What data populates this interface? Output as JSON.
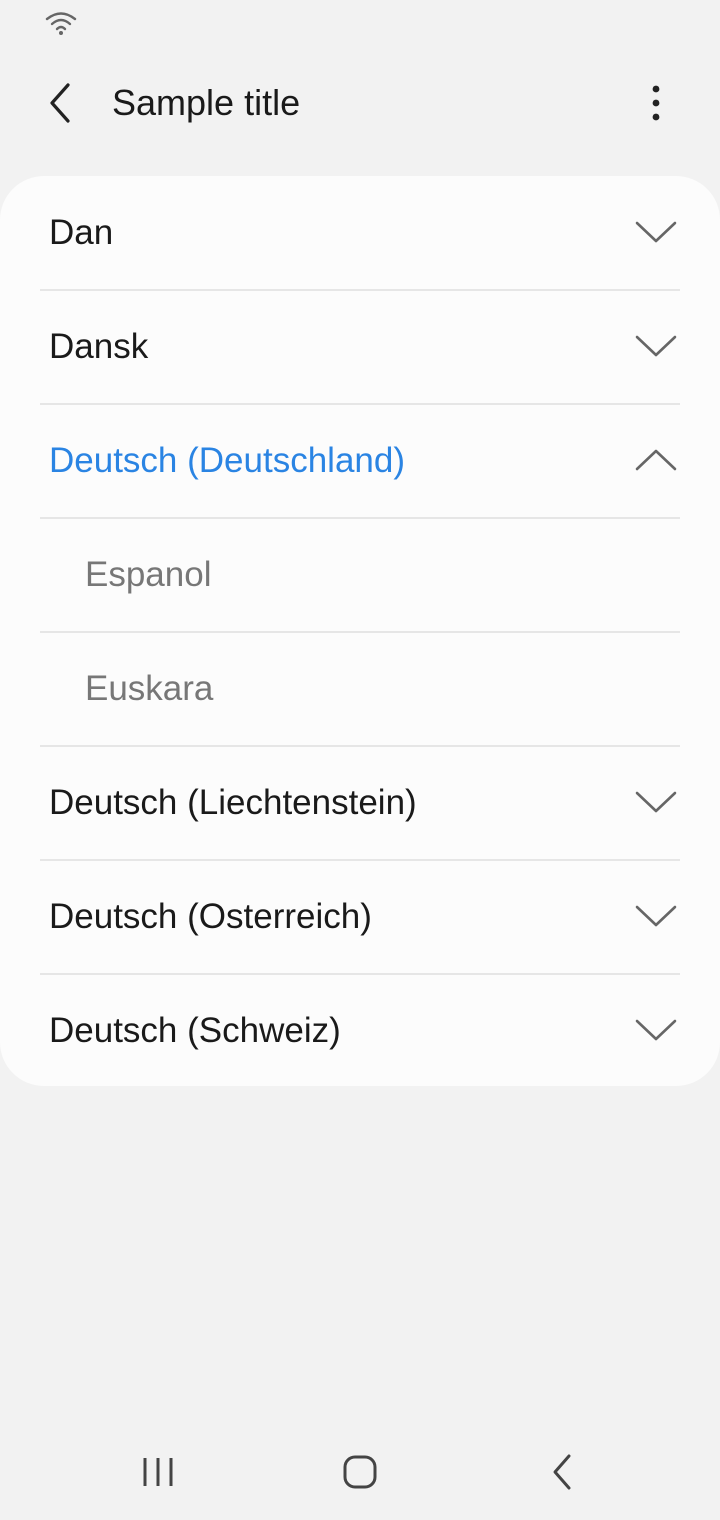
{
  "status_bar": {
    "wifi_icon": "wifi-icon"
  },
  "app_bar": {
    "title": "Sample title",
    "back_icon": "chevron-left-icon",
    "more_icon": "more-vertical-icon"
  },
  "list": {
    "items": [
      {
        "label": "Dan",
        "state": "collapsed"
      },
      {
        "label": "Dansk",
        "state": "collapsed"
      },
      {
        "label": "Deutsch (Deutschland)",
        "state": "expanded"
      },
      {
        "label": "Espanol",
        "state": "child"
      },
      {
        "label": "Euskara",
        "state": "child"
      },
      {
        "label": "Deutsch (Liechtenstein)",
        "state": "collapsed"
      },
      {
        "label": "Deutsch (Osterreich)",
        "state": "collapsed"
      },
      {
        "label": "Deutsch (Schweiz)",
        "state": "collapsed"
      }
    ]
  },
  "colors": {
    "accent": "#2a84e3",
    "background": "#f2f2f2",
    "card": "#fcfcfc",
    "primary_text": "#1a1a1a",
    "secondary_text": "#777777"
  },
  "nav_bar": {
    "recents_icon": "recents-icon",
    "home_icon": "home-icon",
    "back_icon": "back-icon"
  }
}
